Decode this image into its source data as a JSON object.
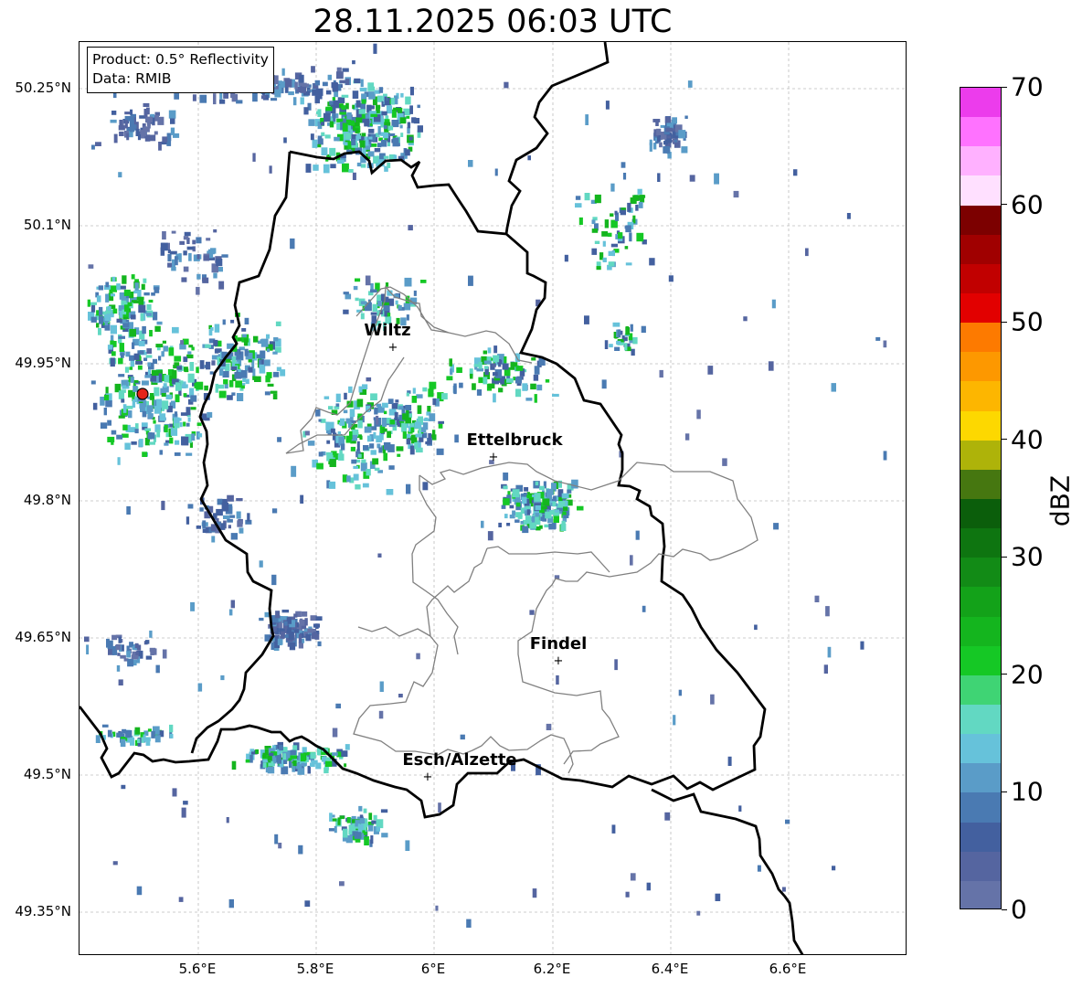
{
  "title": "28.11.2025 06:03 UTC",
  "info_box": {
    "product": "Product: 0.5° Reflectivity",
    "data": "Data: RMIB"
  },
  "lat_labels": [
    "50.25°N",
    "50.1°N",
    "49.95°N",
    "49.8°N",
    "49.65°N",
    "49.5°N",
    "49.35°N"
  ],
  "lon_labels": [
    "5.6°E",
    "5.8°E",
    "6°E",
    "6.2°E",
    "6.4°E",
    "6.6°E"
  ],
  "cities": [
    {
      "name": "Wiltz"
    },
    {
      "name": "Ettelbruck"
    },
    {
      "name": "Findel"
    },
    {
      "name": "Esch/Alzette"
    }
  ],
  "colorbar": {
    "unit": "dBZ",
    "tick_labels": [
      "0",
      "10",
      "20",
      "30",
      "40",
      "50",
      "60",
      "70"
    ],
    "min": 0,
    "max": 70,
    "colors": [
      "#6573a8",
      "#5565a0",
      "#43609f",
      "#4a7ab2",
      "#5a9cc8",
      "#66c2da",
      "#62d8c2",
      "#3fd474",
      "#15c825",
      "#14b51e",
      "#13a219",
      "#128b16",
      "#0e7510",
      "#0b5e0b",
      "#467710",
      "#aeb309",
      "#fdd800",
      "#fdb600",
      "#fd9800",
      "#fd7a00",
      "#e20000",
      "#c10000",
      "#a00000",
      "#7c0000",
      "#ffe0ff",
      "#ffb1ff",
      "#ff72ff",
      "#ec3cec"
    ]
  },
  "radar_site": {
    "color": "#e4241b"
  },
  "map_colors": {
    "country_border": "#000000",
    "canton_border": "#808080",
    "grid": "#bdbdbd"
  }
}
